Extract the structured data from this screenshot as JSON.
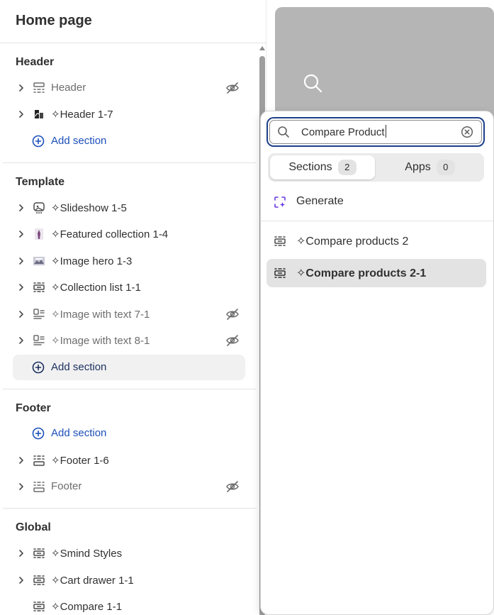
{
  "sidebar": {
    "title": "Home page",
    "groups": {
      "header": {
        "title": "Header",
        "items": [
          {
            "label": "Header",
            "hidden": true
          },
          {
            "label": "✧Header 1-7",
            "hidden": false
          }
        ],
        "add_label": "Add section"
      },
      "template": {
        "title": "Template",
        "items": [
          {
            "label": "✧Slideshow 1-5",
            "hidden": false
          },
          {
            "label": "✧Featured collection 1-4",
            "hidden": false
          },
          {
            "label": "✧Image hero 1-3",
            "hidden": false
          },
          {
            "label": "✧Collection list 1-1",
            "hidden": false
          },
          {
            "label": "✧Image with text 7-1",
            "hidden": true
          },
          {
            "label": "✧Image with text 8-1",
            "hidden": true
          }
        ],
        "add_label": "Add section"
      },
      "footer": {
        "title": "Footer",
        "add_label": "Add section",
        "items": [
          {
            "label": "✧Footer 1-6",
            "hidden": false
          },
          {
            "label": "Footer",
            "hidden": true
          }
        ]
      },
      "global": {
        "title": "Global",
        "items": [
          {
            "label": "✧Smind Styles",
            "hidden": false
          },
          {
            "label": "✧Cart drawer 1-1",
            "hidden": false
          },
          {
            "label": "✧Compare 1-1",
            "hidden": false
          }
        ]
      }
    }
  },
  "popover": {
    "search": {
      "value": "Compare Product"
    },
    "tabs": [
      {
        "label": "Sections",
        "count": "2",
        "selected": true
      },
      {
        "label": "Apps",
        "count": "0",
        "selected": false
      }
    ],
    "generate_label": "Generate",
    "results": [
      {
        "label": "✧Compare products 2",
        "highlighted": false
      },
      {
        "label": "✧Compare products 2-1",
        "highlighted": true
      }
    ]
  },
  "colors": {
    "link": "#1c4fb9",
    "focus_ring": "#1c3f8a",
    "generate_accent": "#6c3ae0",
    "preview_card": "#b5b5b5"
  },
  "icons": {
    "chevron": "chevron-right-icon",
    "hidden": "eye-slash-icon",
    "add": "plus-circle-icon",
    "section": "section-layout-icon",
    "search": "search-icon",
    "clear": "clear-circle-icon",
    "generate": "sparkle-generate-icon"
  }
}
